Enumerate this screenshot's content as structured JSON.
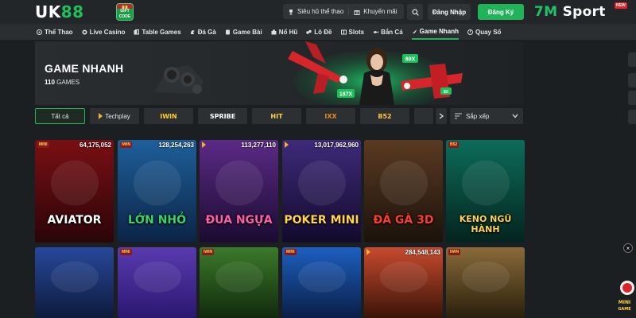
{
  "header": {
    "logo_text_main": "UK",
    "logo_text_accent": "88",
    "logo_badge_text": "GIFT CODE",
    "super_jackpot": "Siêu hũ thể thao",
    "promotions": "Khuyến mãi",
    "login_label": "Đăng Nhập",
    "register_label": "Đăng Ký",
    "partner_brand_a": "7M",
    "partner_brand_b": "Sport",
    "new_badge": "NEW",
    "accent_color": "#21b35a"
  },
  "nav": {
    "items": [
      {
        "label": "Thể Thao",
        "icon": "soccer-icon"
      },
      {
        "label": "Live Casino",
        "icon": "casino-chip-icon"
      },
      {
        "label": "Table Games",
        "icon": "cards-icon"
      },
      {
        "label": "Đá Gà",
        "icon": "rooster-icon"
      },
      {
        "label": "Game Bài",
        "icon": "card-game-icon"
      },
      {
        "label": "Nổ Hũ",
        "icon": "jackpot-icon"
      },
      {
        "label": "Lô Đề",
        "icon": "lottery-icon"
      },
      {
        "label": "Slots",
        "icon": "slots-icon"
      },
      {
        "label": "Bắn Cá",
        "icon": "fish-icon"
      },
      {
        "label": "Game Nhanh",
        "icon": "rocket-icon"
      },
      {
        "label": "Quay Số",
        "icon": "spin-icon"
      }
    ],
    "active_index": 9
  },
  "banner": {
    "title": "GAME NHANH",
    "count_number": "110",
    "count_label": "GAMES",
    "badge_89x": "89X",
    "badge_187x": "187X",
    "badge_8x": "8X"
  },
  "filters": {
    "all_label": "Tất cả",
    "providers": [
      "Techplay",
      "IWIN",
      "SPRIBE",
      "HIT",
      "IXX",
      "B52"
    ],
    "sort_label": "Sắp xếp"
  },
  "games_row1": [
    {
      "title": "AVIATOR",
      "count": "64,175,052",
      "provider": "MINI"
    },
    {
      "title": "LỚN NHỎ",
      "count": "128,254,263",
      "provider": "IWIN"
    },
    {
      "title": "ĐUA NGỰA",
      "count": "113,277,110",
      "provider": "tri"
    },
    {
      "title": "POKER MINI",
      "count": "13,017,962,960",
      "provider": "tri"
    },
    {
      "title": "ĐÁ GÀ 3D",
      "count": "",
      "provider": ""
    },
    {
      "title": "KENO NGŨ HÀNH",
      "count": "",
      "provider": "B52"
    }
  ],
  "games_row2": [
    {
      "title": "",
      "count": "",
      "provider": ""
    },
    {
      "title": "",
      "count": "",
      "provider": "MINI"
    },
    {
      "title": "",
      "count": "",
      "provider": "IWIN"
    },
    {
      "title": "",
      "count": "",
      "provider": "MINI"
    },
    {
      "title": "",
      "count": "284,548,143",
      "provider": "tri"
    },
    {
      "title": "",
      "count": "",
      "provider": "IWIN"
    }
  ],
  "floating": {
    "close": "×",
    "mini_game_label": "MINI GAME"
  }
}
